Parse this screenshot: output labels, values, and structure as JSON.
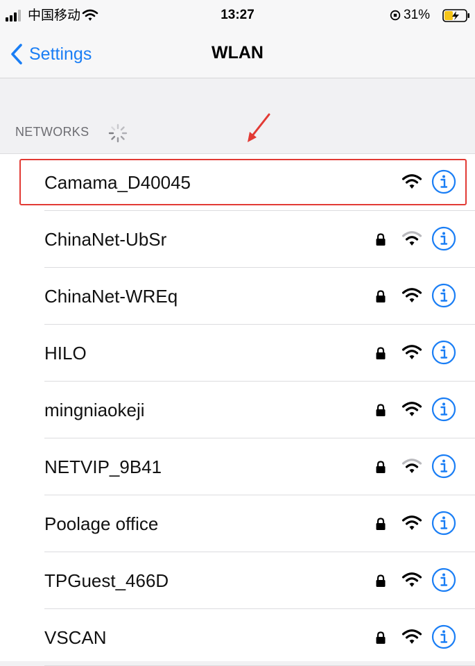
{
  "status_bar": {
    "carrier": "中国移动",
    "time": "13:27",
    "battery_percent": "31%",
    "signal_bars_filled": 3,
    "signal_bars_total": 4
  },
  "nav": {
    "back_label": "Settings",
    "title": "WLAN",
    "accent_color": "#1a7ef5"
  },
  "section": {
    "header": "NETWORKS",
    "scanning": true
  },
  "annotation": {
    "color": "#e23a34",
    "highlighted_network": "Camama_D40045"
  },
  "networks": [
    {
      "name": "Camama_D40045",
      "locked": false,
      "signal": "strong",
      "highlighted": true
    },
    {
      "name": "ChinaNet-UbSr",
      "locked": true,
      "signal": "weak",
      "highlighted": false
    },
    {
      "name": "ChinaNet-WREq",
      "locked": true,
      "signal": "strong",
      "highlighted": false
    },
    {
      "name": "HILO",
      "locked": true,
      "signal": "strong",
      "highlighted": false
    },
    {
      "name": "mingniaokeji",
      "locked": true,
      "signal": "strong",
      "highlighted": false
    },
    {
      "name": "NETVIP_9B41",
      "locked": true,
      "signal": "weak",
      "highlighted": false
    },
    {
      "name": "Poolage office",
      "locked": true,
      "signal": "strong",
      "highlighted": false
    },
    {
      "name": "TPGuest_466D",
      "locked": true,
      "signal": "strong",
      "highlighted": false
    },
    {
      "name": "VSCAN",
      "locked": true,
      "signal": "strong",
      "highlighted": false
    }
  ]
}
